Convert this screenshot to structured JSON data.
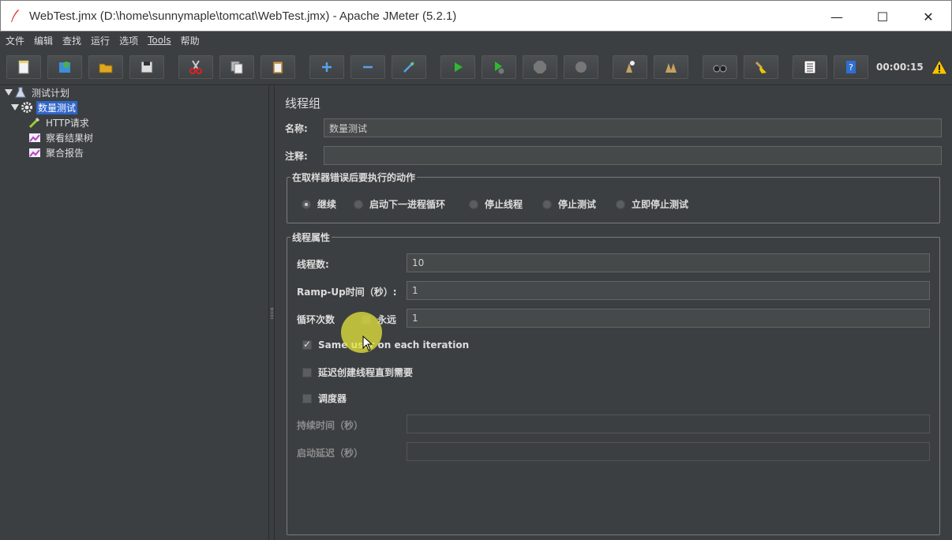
{
  "window": {
    "title": "WebTest.jmx (D:\\home\\sunnymaple\\tomcat\\WebTest.jmx) - Apache JMeter (5.2.1)",
    "minimize_glyph": "—",
    "maximize_glyph": "☐",
    "close_glyph": "✕"
  },
  "menu": [
    "文件",
    "编辑",
    "查找",
    "运行",
    "选项",
    "Tools",
    "帮助"
  ],
  "toolbar": {
    "timer": "00:00:15",
    "icons": [
      "new-icon",
      "templates-icon",
      "open-icon",
      "save-icon",
      "cut-icon",
      "copy-icon",
      "paste-icon",
      "expand-icon",
      "collapse-icon",
      "toggle-icon",
      "start-icon",
      "start-no-pause-icon",
      "stop-icon",
      "shutdown-icon",
      "clear-icon",
      "clear-all-icon",
      "search-icon",
      "reset-search-icon",
      "function-helper-icon",
      "help-icon",
      "warning-icon"
    ]
  },
  "tree": {
    "items": [
      {
        "label": "测试计划"
      },
      {
        "label": "数量测试"
      },
      {
        "label": "HTTP请求"
      },
      {
        "label": "察看结果树"
      },
      {
        "label": "聚合报告"
      }
    ]
  },
  "panel": {
    "title": "线程组",
    "name_label": "名称:",
    "name_value": "数量测试",
    "comment_label": "注释:",
    "comment_value": "",
    "error_group": {
      "legend": "在取样器错误后要执行的动作",
      "options": [
        "继续",
        "启动下一进程循环",
        "停止线程",
        "停止测试",
        "立即停止测试"
      ],
      "selected": 0
    },
    "thread_props": {
      "legend": "线程属性",
      "threads_label": "线程数:",
      "threads_value": "10",
      "rampup_label": "Ramp-Up时间（秒）:",
      "rampup_value": "1",
      "loop_label": "循环次数",
      "forever_label": "永远",
      "loop_value": "1",
      "same_user_label": "Same user on each iteration",
      "same_user_checked": true,
      "delay_create_label": "延迟创建线程直到需要",
      "scheduler_label": "调度器",
      "duration_label": "持续时间（秒）",
      "duration_value": "",
      "startup_delay_label": "启动延迟（秒）",
      "startup_delay_value": ""
    }
  }
}
